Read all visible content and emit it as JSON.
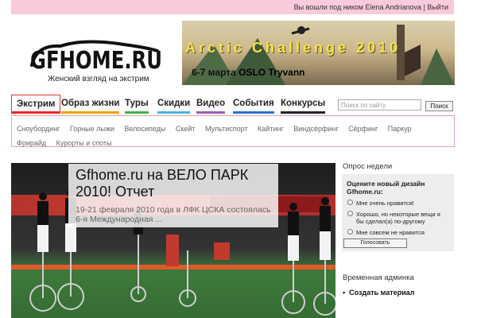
{
  "topbar": {
    "text": "Вы вошли под ником Elena Andrianova | Выйти"
  },
  "logo": {
    "brand": "GFHOME.RU",
    "tagline": "Женский взгляд на экстрим"
  },
  "banner": {
    "title": "Arctic   Challenge   2010",
    "date_prefix": "6-7 марта",
    "date_place": "OSLO Tryvann"
  },
  "nav": {
    "items": [
      {
        "label": "Экстрим",
        "color": "#e52a2a"
      },
      {
        "label": "Образ жизни",
        "color": "#f0a000"
      },
      {
        "label": "Туры",
        "color": "#3cb34a"
      },
      {
        "label": "Скидки",
        "color": "#46b7e0"
      },
      {
        "label": "Видео",
        "color": "#9b59b6"
      },
      {
        "label": "События",
        "color": "#2a6fd6"
      },
      {
        "label": "Конкурсы",
        "color": "#222222"
      }
    ]
  },
  "search": {
    "placeholder": "Поиск по сайту",
    "button": "Поиск"
  },
  "subnav": {
    "items": [
      "Сноубординг",
      "Горные лыжи",
      "Велосипеды",
      "Скейт",
      "Мультиспорт",
      "Кайтинг",
      "Виндсёрфинг",
      "Сёрфинг",
      "Паркур",
      "Фрирайд",
      "Курорты и споты"
    ]
  },
  "feature": {
    "title": "Gfhome.ru на ВЕЛО ПАРК 2010! Отчет",
    "text": "19-21 февраля 2010 года в ЛФК ЦСКА состоялась 6-я Международная ..."
  },
  "poll": {
    "heading": "Опрос недели",
    "question": "Оцените новый дизайн Gfhome.ru:",
    "options": [
      "Мне очень нравится!",
      "Хорошо, но некоторые вещи я бы сделал(а) по-другому",
      "Мне совсем не нравится"
    ],
    "vote": "Голосовать"
  },
  "admin": {
    "heading": "Временная админка",
    "link": "Создать материал"
  }
}
